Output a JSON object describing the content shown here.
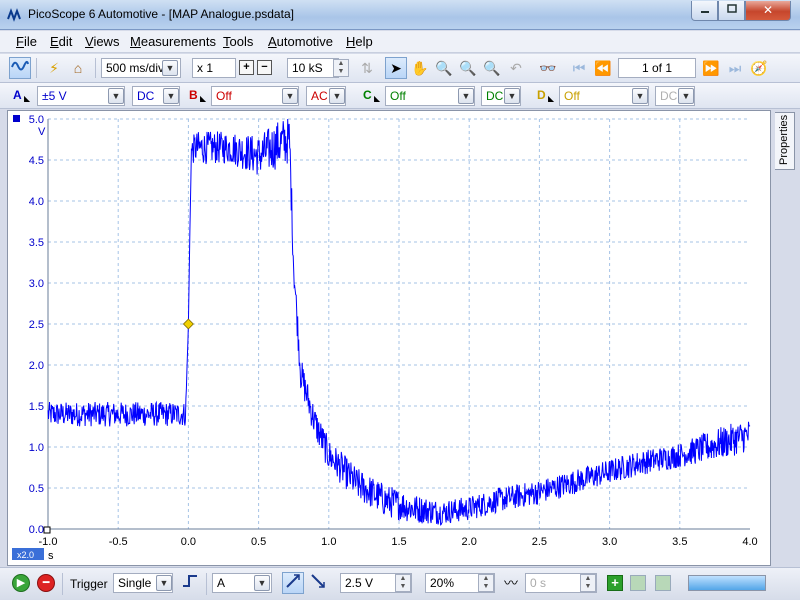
{
  "window": {
    "title": "PicoScope 6 Automotive - [MAP Analogue.psdata]"
  },
  "menu": [
    "File",
    "Edit",
    "Views",
    "Measurements",
    "Tools",
    "Automotive",
    "Help"
  ],
  "toolbar": {
    "timebase": "500 ms/div",
    "zoom": "x 1",
    "samples": "10 kS",
    "page_counter": "1 of 1"
  },
  "channels": [
    {
      "letter": "A",
      "range": "±5 V",
      "coupling": "DC",
      "color": "#0000cc"
    },
    {
      "letter": "B",
      "range": "Off",
      "coupling": "AC",
      "color": "#cc0000"
    },
    {
      "letter": "C",
      "range": "Off",
      "coupling": "DC",
      "color": "#008000"
    },
    {
      "letter": "D",
      "range": "Off",
      "coupling": "DC",
      "color": "#c8a000"
    }
  ],
  "plot": {
    "y_unit": "V",
    "x_unit": "s",
    "zoom_badge": "x2.0",
    "properties_tab": "Properties",
    "trace_color": "#0000ff",
    "trigger_marker_color": "#f0d000"
  },
  "chart_data": {
    "type": "line",
    "xlim": [
      -1.0,
      4.0
    ],
    "ylim": [
      0.0,
      5.0
    ],
    "x_ticks": [
      "-1.0",
      "-0.5",
      "0.0",
      "0.5",
      "1.0",
      "1.5",
      "2.0",
      "2.5",
      "3.0",
      "3.5",
      "4.0"
    ],
    "y_ticks": [
      "0.0",
      "0.5",
      "1.0",
      "1.5",
      "2.0",
      "2.5",
      "3.0",
      "3.5",
      "4.0",
      "4.5",
      "5.0"
    ],
    "grid": true,
    "trigger_point": {
      "x": 0.0,
      "y": 2.5
    },
    "series": [
      {
        "x": [
          -1.0,
          -0.5,
          -0.02,
          0.0,
          0.02,
          0.05,
          0.3,
          0.5,
          0.65,
          0.72,
          0.75,
          0.8,
          0.9,
          1.0,
          1.2,
          1.4,
          1.6,
          1.8,
          2.0,
          2.2,
          2.5,
          2.8,
          3.0,
          3.2,
          3.5,
          3.8,
          4.0
        ],
        "y": [
          1.4,
          1.4,
          1.4,
          2.5,
          4.6,
          4.65,
          4.65,
          4.55,
          4.7,
          4.75,
          3.2,
          1.9,
          1.3,
          0.9,
          0.55,
          0.35,
          0.25,
          0.2,
          0.25,
          0.35,
          0.45,
          0.6,
          0.7,
          0.8,
          0.9,
          1.05,
          1.15
        ],
        "noise": [
          0.15,
          0.15,
          0.15,
          0.0,
          0.15,
          0.2,
          0.2,
          0.25,
          0.3,
          0.3,
          0.2,
          0.2,
          0.2,
          0.2,
          0.2,
          0.2,
          0.18,
          0.15,
          0.15,
          0.15,
          0.15,
          0.15,
          0.15,
          0.15,
          0.15,
          0.2,
          0.2
        ]
      }
    ]
  },
  "statusbar": {
    "trigger_label": "Trigger",
    "trigger_mode": "Single",
    "trigger_source": "A",
    "threshold": "2.5 V",
    "pretrigger": "20%",
    "delay": "0 s"
  }
}
